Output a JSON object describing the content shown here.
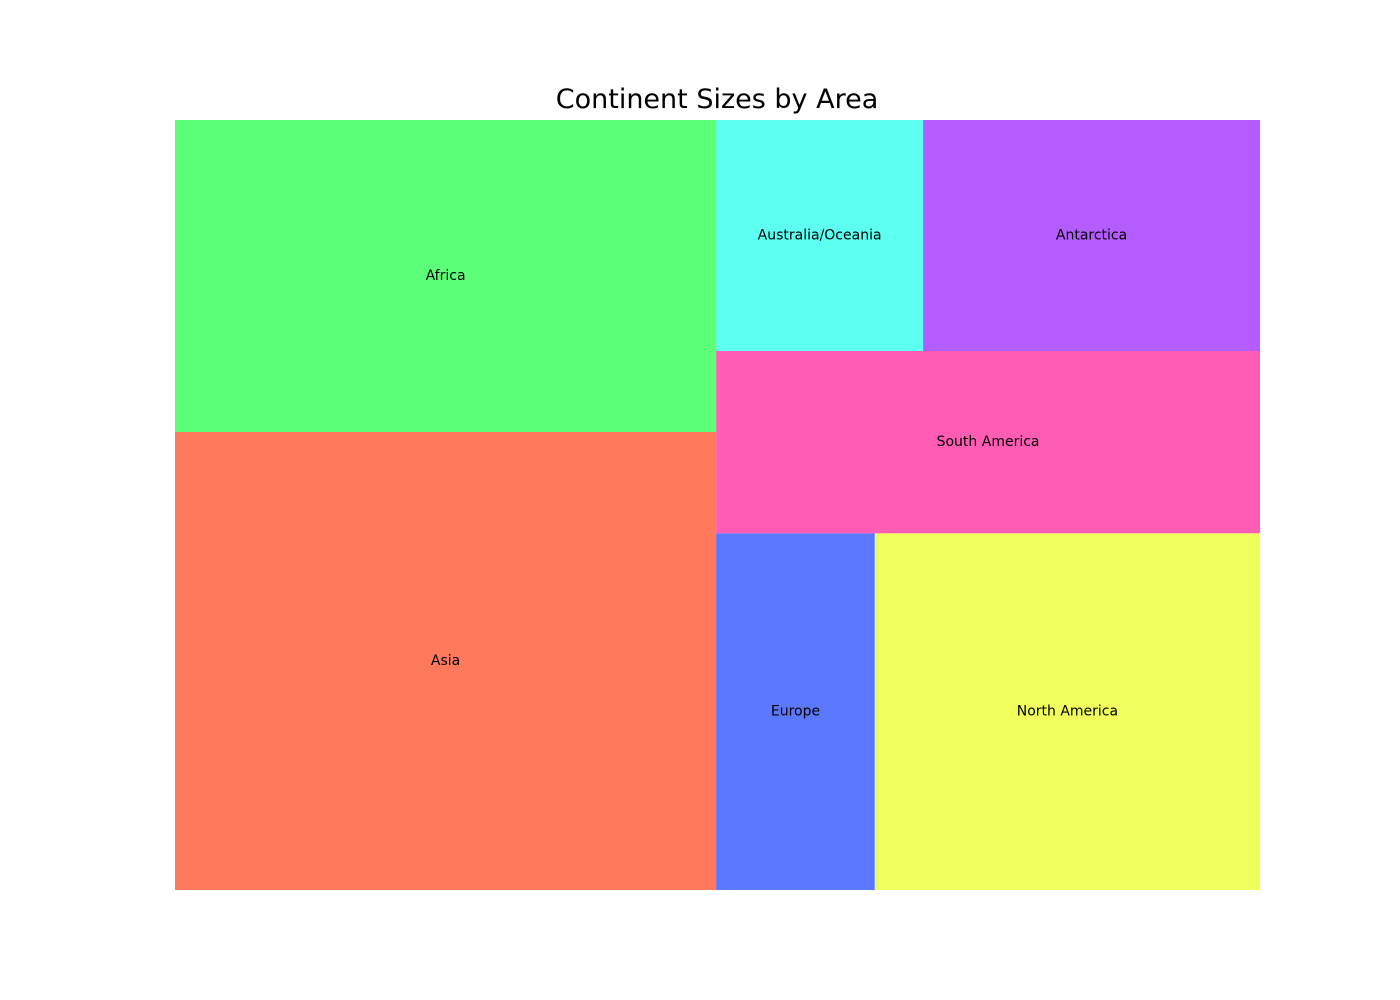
{
  "chart_data": {
    "type": "treemap",
    "title": "Continent Sizes by Area",
    "items": [
      {
        "label": "Asia",
        "value": 44.58,
        "color": "#ff7a5c"
      },
      {
        "label": "Africa",
        "value": 30.37,
        "color": "#5cff78"
      },
      {
        "label": "Europe",
        "value": 10.18,
        "color": "#5c78ff"
      },
      {
        "label": "North America",
        "value": 24.71,
        "color": "#f0ff5c"
      },
      {
        "label": "South America",
        "value": 17.84,
        "color": "#ff5cb4"
      },
      {
        "label": "Australia/Oceania",
        "value": 8.6,
        "color": "#5cfff0"
      },
      {
        "label": "Antarctica",
        "value": 14.0,
        "color": "#b45cff"
      }
    ]
  }
}
